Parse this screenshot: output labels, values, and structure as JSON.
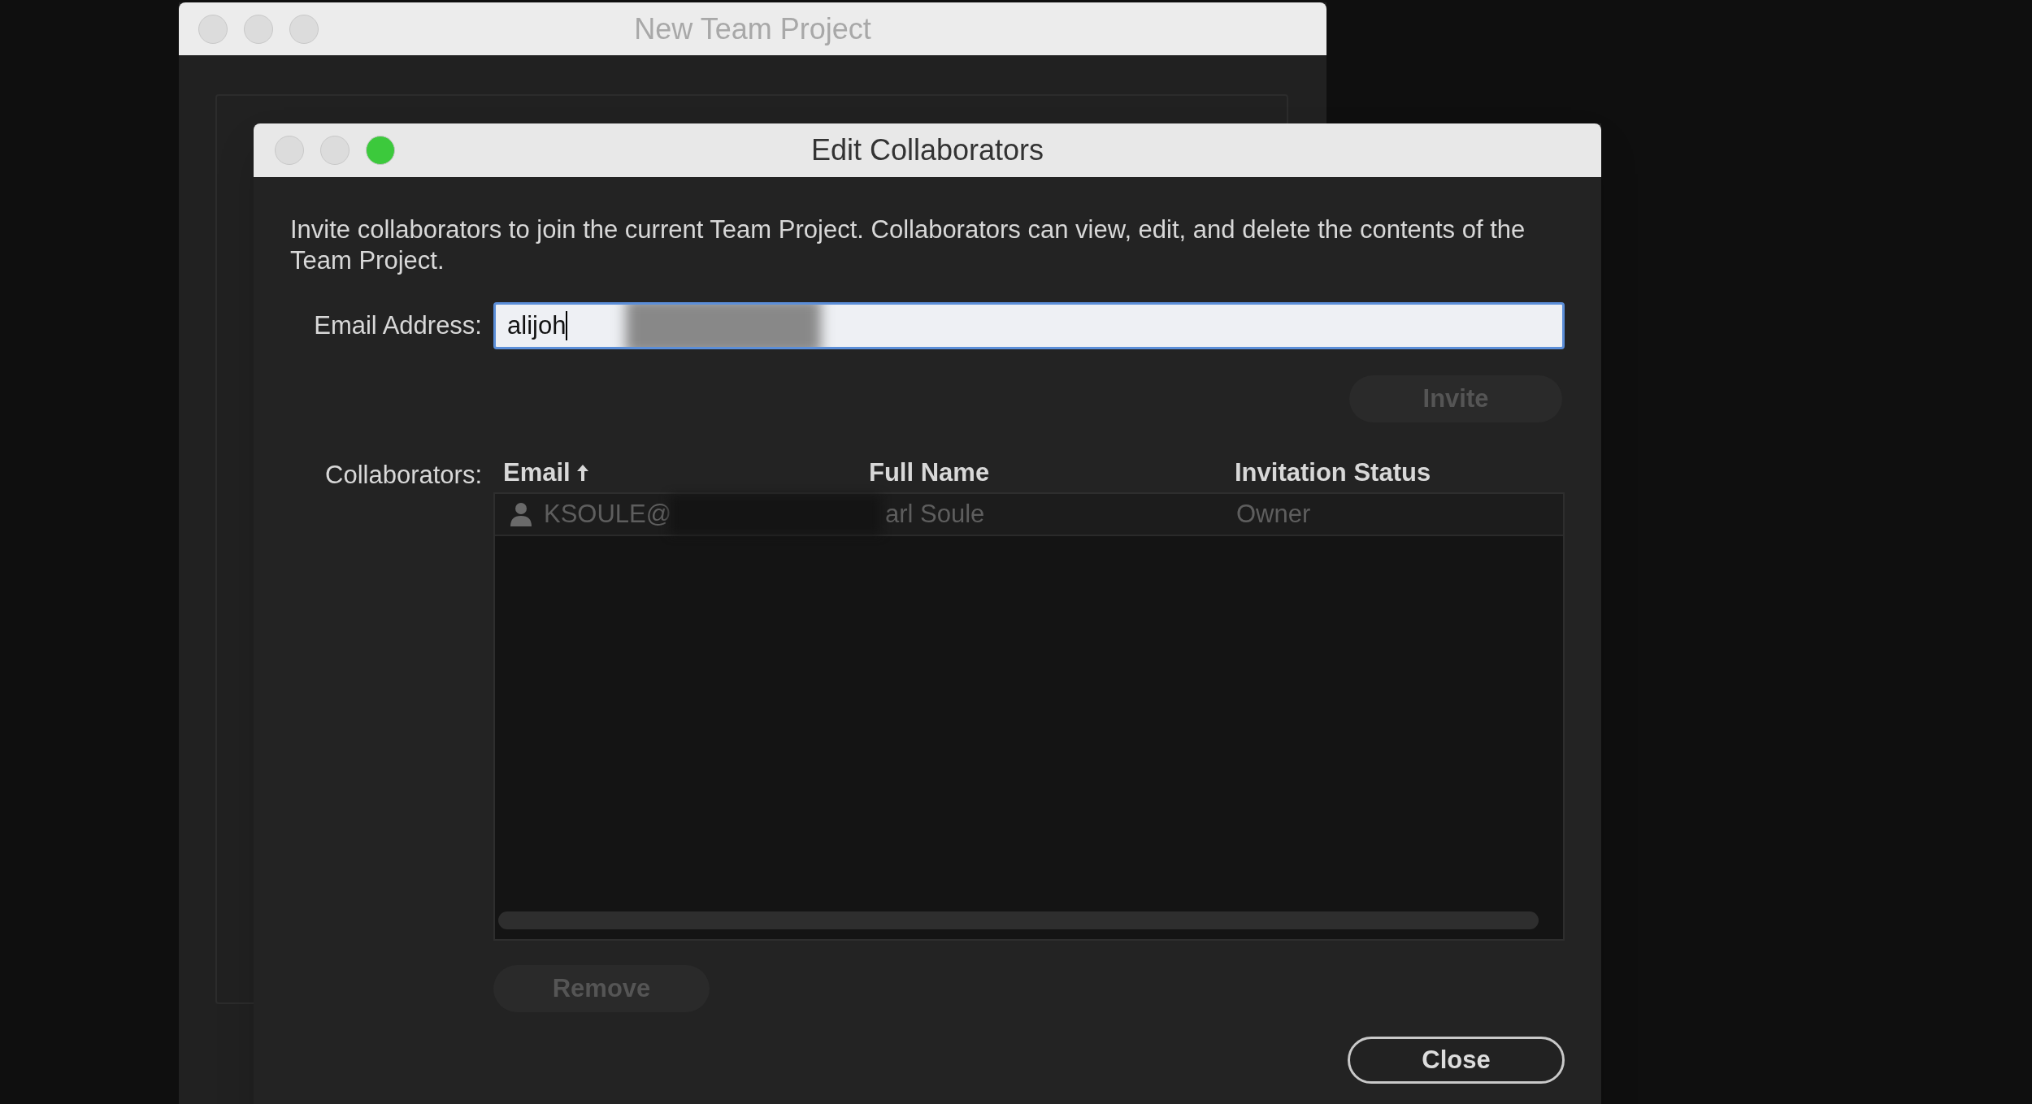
{
  "background_window": {
    "title": "New Team Project"
  },
  "dialog": {
    "title": "Edit Collaborators",
    "description": "Invite collaborators to join the current Team Project. Collaborators can view, edit, and delete the contents of the Team Project.",
    "email_field": {
      "label": "Email Address:",
      "value": "alijoh"
    },
    "invite_button": {
      "label": "Invite",
      "disabled": true
    },
    "collaborators": {
      "label": "Collaborators:",
      "columns": [
        {
          "label": "Email",
          "sorted_ascending": true
        },
        {
          "label": "Full Name",
          "sorted_ascending": false
        },
        {
          "label": "Invitation Status",
          "sorted_ascending": false
        }
      ],
      "rows": [
        {
          "email": "KSOULE@",
          "full_name": "arl Soule",
          "status": "Owner"
        }
      ]
    },
    "remove_button": {
      "label": "Remove",
      "disabled": true
    },
    "close_button": {
      "label": "Close",
      "disabled": false
    }
  }
}
